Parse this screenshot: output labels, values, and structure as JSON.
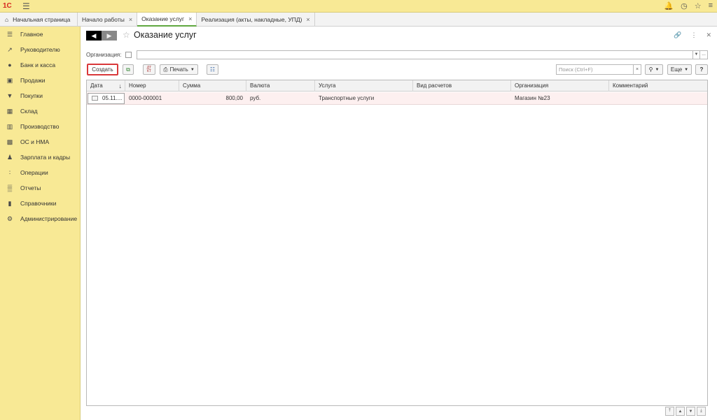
{
  "topbar": {
    "logo": "1С",
    "icons": [
      "menu-icon",
      "bell-icon",
      "history-icon",
      "star-icon",
      "settings-menu-icon"
    ]
  },
  "tabs": [
    {
      "label": "Начальная страница",
      "icon": "home-icon"
    },
    {
      "label": "Начало работы",
      "closable": true
    },
    {
      "label": "Оказание услуг",
      "closable": true,
      "active": true
    },
    {
      "label": "Реализация (акты, накладные, УПД)",
      "closable": true
    }
  ],
  "sidebar": {
    "items": [
      {
        "label": "Главное",
        "icon": "list-icon"
      },
      {
        "label": "Руководителю",
        "icon": "trend-icon"
      },
      {
        "label": "Банк и касса",
        "icon": "coin-icon"
      },
      {
        "label": "Продажи",
        "icon": "bag-icon"
      },
      {
        "label": "Покупки",
        "icon": "cart-icon"
      },
      {
        "label": "Склад",
        "icon": "warehouse-icon"
      },
      {
        "label": "Производство",
        "icon": "factory-icon"
      },
      {
        "label": "ОС и НМА",
        "icon": "truck-icon"
      },
      {
        "label": "Зарплата и кадры",
        "icon": "person-icon"
      },
      {
        "label": "Операции",
        "icon": "operations-icon"
      },
      {
        "label": "Отчеты",
        "icon": "chart-icon"
      },
      {
        "label": "Справочники",
        "icon": "book-icon"
      },
      {
        "label": "Администрирование",
        "icon": "gear-icon"
      }
    ]
  },
  "page": {
    "title": "Оказание услуг",
    "org_label": "Организация:",
    "org_value": ""
  },
  "toolbar": {
    "create_label": "Создать",
    "print_label": "Печать",
    "dtkt_top": "ДТ",
    "dtkt_bottom": "КТ",
    "search_placeholder": "Поиск (Ctrl+F)",
    "more_label": "Еще",
    "help_label": "?"
  },
  "table": {
    "columns": [
      "Дата",
      "Номер",
      "Сумма",
      "Валюта",
      "Услуга",
      "Вид расчетов",
      "Организация",
      "Комментарий"
    ],
    "rows": [
      {
        "date": "05.11....",
        "number": "0000-000001",
        "sum": "800,00",
        "currency": "руб.",
        "service": "Транспортные услуги",
        "calc_type": "",
        "org": "Магазин №23",
        "comment": ""
      }
    ]
  },
  "colors": {
    "sidebar_bg": "#f8e995",
    "create_border": "#d9383a",
    "active_tab_accent": "#60a840",
    "selected_row": "#fdf0f0"
  }
}
